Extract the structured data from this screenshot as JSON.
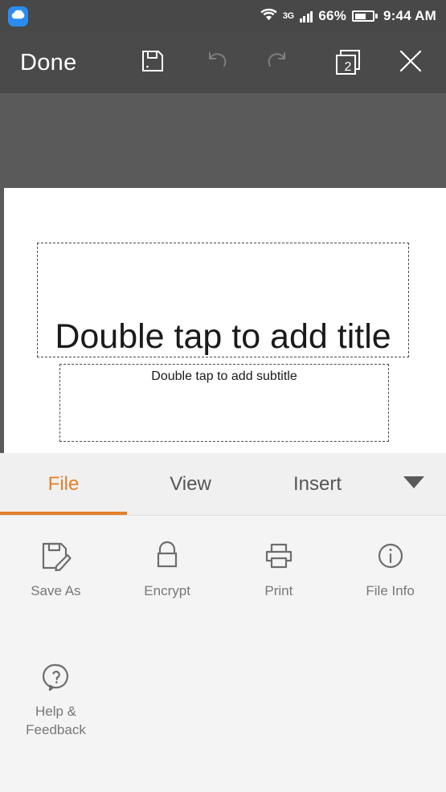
{
  "status_bar": {
    "app_badge_icon": "cloud-icon",
    "wifi_icon": "wifi-icon",
    "network_label": "3G",
    "signal_icon": "signal-bars-icon",
    "battery_percent": "66%",
    "battery_level": 66,
    "battery_icon": "battery-icon",
    "time": "9:44 AM",
    "background_color": "#484848"
  },
  "toolbar": {
    "done_label": "Done",
    "save_icon": "save-floppy-icon",
    "undo_icon": "undo-arrow-icon",
    "redo_icon": "redo-arrow-icon",
    "slides_icon": "slide-stack-icon",
    "slide_count": "2",
    "close_icon": "close-x-icon",
    "background_color": "#4a4a4a",
    "disabled_color": "#7e7e7e"
  },
  "slide": {
    "background_color": "#5a5a5a",
    "paper_color": "#ffffff",
    "title_placeholder": "Double tap to add title",
    "subtitle_placeholder": "Double tap to add subtitle"
  },
  "tabs": {
    "accent_color": "#e2802b",
    "items": [
      {
        "label": "File",
        "active": true
      },
      {
        "label": "View",
        "active": false
      },
      {
        "label": "Insert",
        "active": false
      }
    ],
    "overflow_icon": "chevron-down-icon"
  },
  "file_menu": {
    "row1": [
      {
        "label": "Save As",
        "icon": "save-as-icon"
      },
      {
        "label": "Encrypt",
        "icon": "lock-icon"
      },
      {
        "label": "Print",
        "icon": "printer-icon"
      },
      {
        "label": "File Info",
        "icon": "info-circle-icon"
      }
    ],
    "row2": [
      {
        "label": "Help &\nFeedback",
        "label_line1": "Help &",
        "label_line2": "Feedback",
        "icon": "help-bubble-icon"
      }
    ],
    "background_color": "#f4f4f4",
    "label_color": "#777777"
  }
}
